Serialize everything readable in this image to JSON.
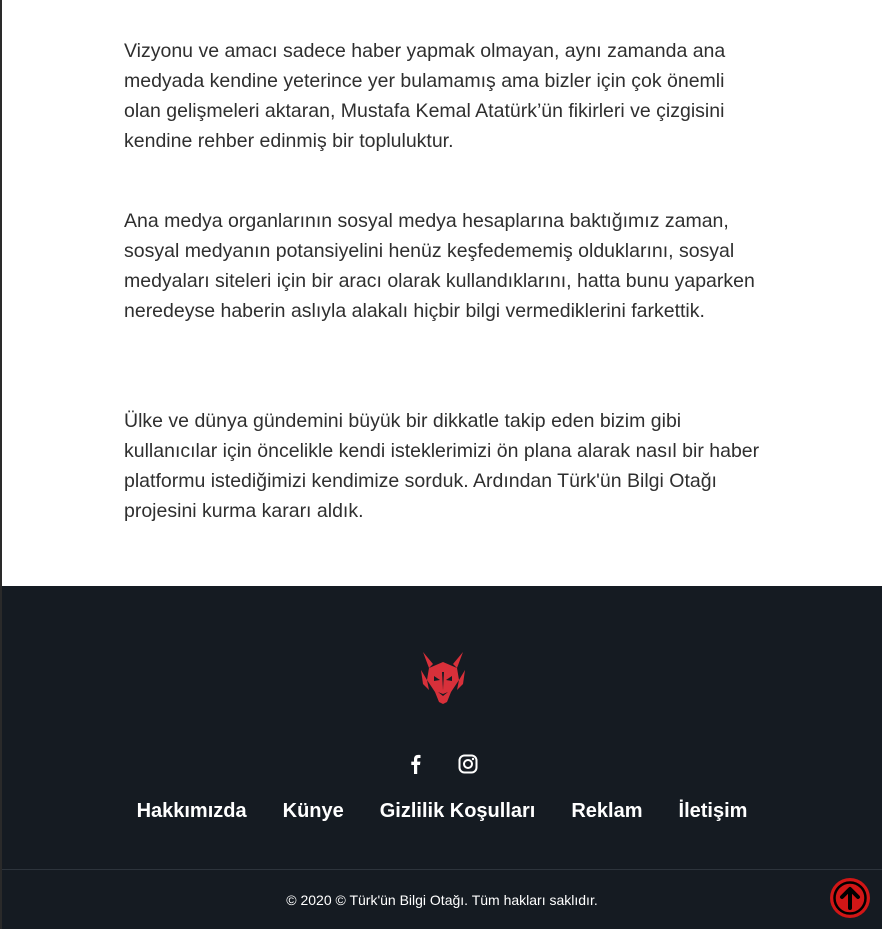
{
  "article": {
    "paragraphs": [
      "Vizyonu ve amacı sadece haber yapmak olmayan, aynı zamanda ana medyada kendine yeterince yer bulamamış ama bizler için çok önemli olan gelişmeleri aktaran, Mustafa Kemal Atatürk’ün fikirleri ve çizgisini kendine rehber edinmiş bir topluluktur.",
      "Ana medya organlarının sosyal medya hesaplarına baktığımız zaman, sosyal medyanın potansiyelini henüz keşfedememiş olduklarını, sosyal medyaları siteleri için bir aracı olarak kullandıklarını, hatta bunu yaparken neredeyse haberin aslıyla alakalı hiçbir bilgi vermediklerini farkettik.",
      "Ülke ve dünya gündemini büyük bir dikkatle takip eden bizim gibi kullanıcılar için öncelikle kendi isteklerimizi ön plana alarak nasıl bir haber platformu istediğimizi kendimize sorduk. Ardından Türk'ün Bilgi Otağı projesini kurma kararı aldık."
    ]
  },
  "footer": {
    "logo_icon": "wolf-head-logo",
    "social": [
      {
        "icon": "facebook-icon"
      },
      {
        "icon": "instagram-icon"
      }
    ],
    "nav": [
      "Hakkımızda",
      "Künye",
      "Gizlilik Koşulları",
      "Reklam",
      "İletişim"
    ],
    "copyright": "© 2020 © Türk'ün Bilgi Otağı. Tüm hakları saklıdır."
  },
  "scroll_top": {
    "icon": "arrow-up-icon",
    "color": "#d11616"
  },
  "colors": {
    "footer_bg": "#151b22",
    "accent": "#d8303a",
    "text": "#2f2f2f"
  }
}
